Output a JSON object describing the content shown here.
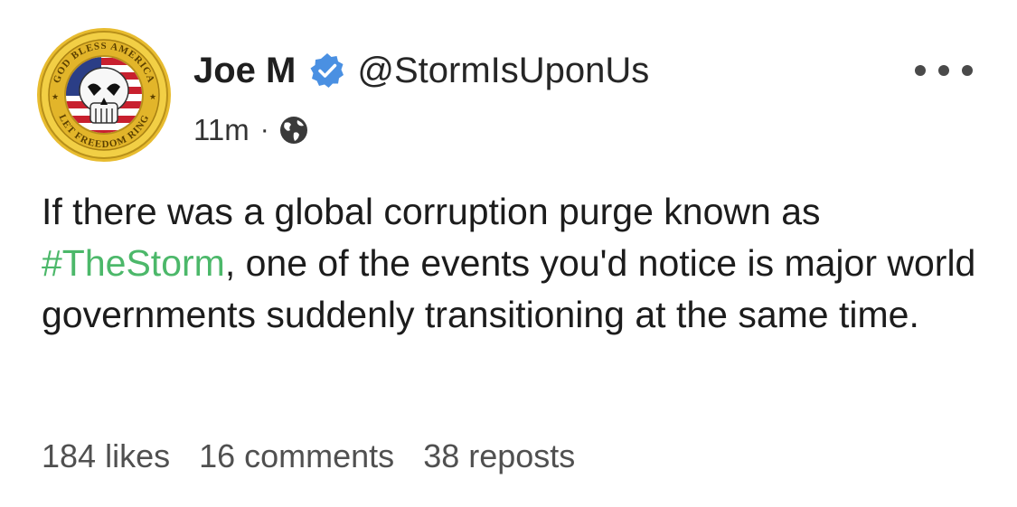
{
  "post": {
    "author": {
      "display_name": "Joe M",
      "handle": "@StormIsUponUs",
      "verified": true,
      "avatar": {
        "icon": "skull-flag-seal-icon",
        "seal_text_top": "GOD BLESS AMERICA",
        "seal_text_bottom": "LET FREEDOM RING"
      }
    },
    "timestamp": "11m",
    "meta_separator": "·",
    "visibility_icon": "globe-icon",
    "more_icon": "more-options-icon",
    "text_before": "If there was a global corruption purge known as ",
    "hashtag": "#TheStorm",
    "text_after": ", one of the events you'd notice is major world governments suddenly transitioning at the same time.",
    "stats": {
      "likes": "184 likes",
      "comments": "16 comments",
      "reposts": "38 reposts"
    },
    "colors": {
      "hashtag": "#4cb86a",
      "verified_badge": "#4a90e2",
      "seal_gold": "#e6b82e"
    }
  }
}
